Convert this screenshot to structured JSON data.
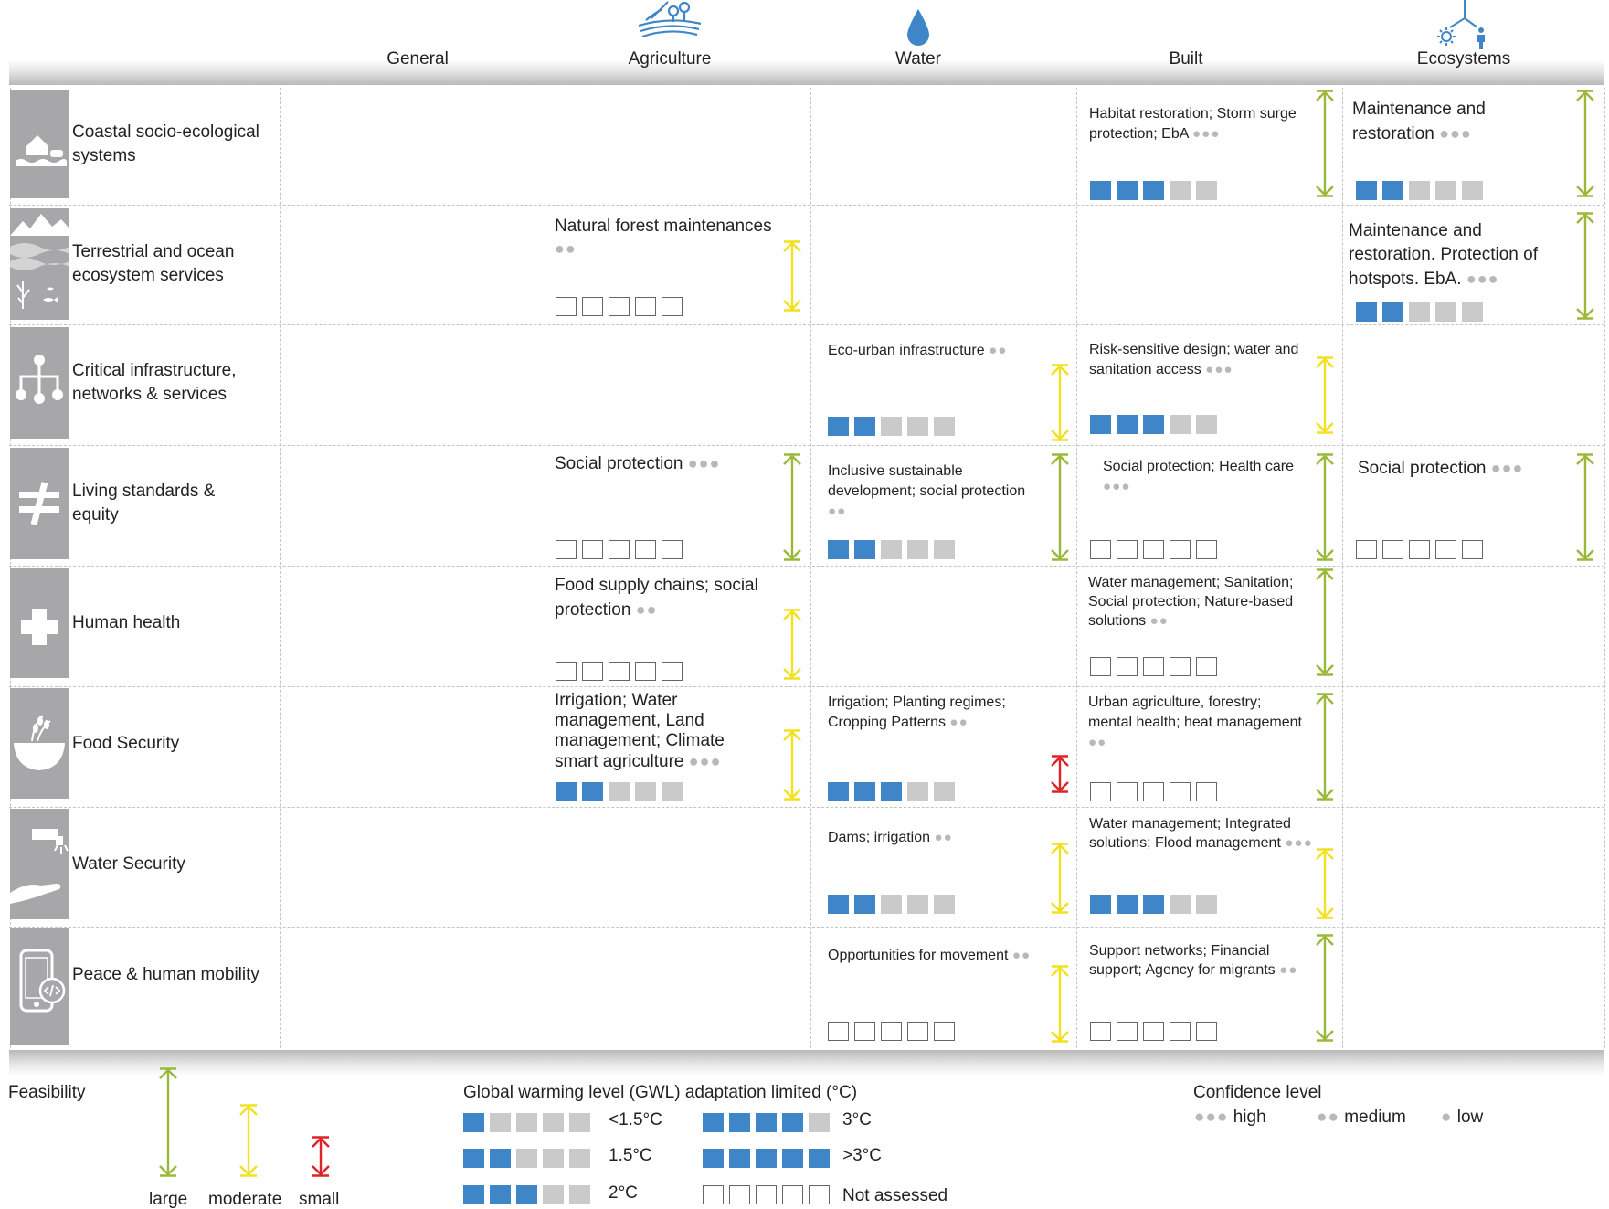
{
  "colors": {
    "blue": "#3f86c8",
    "grey": "#cacaca",
    "icon_bg": "#a7a7a9",
    "large": "#9bb83a",
    "moderate": "#f2e11e",
    "small": "#e02228",
    "dots": "#b8b8b8"
  },
  "columns": [
    {
      "label": "General",
      "icon": ""
    },
    {
      "label": "Agriculture",
      "icon": "fields-icon"
    },
    {
      "label": "Water",
      "icon": "water-drop-icon"
    },
    {
      "label": "Built",
      "icon": ""
    },
    {
      "label": "Ecosystems",
      "icon": "ecosystem-network-icon"
    }
  ],
  "rows": [
    {
      "label": "Coastal socio-ecological systems",
      "icon": "coastal-house-icon"
    },
    {
      "label": "Terrestrial and ocean ecosystem services",
      "icon": "mountain-ocean-icon"
    },
    {
      "label": "Critical infrastructure, networks & services",
      "icon": "network-tree-icon"
    },
    {
      "label": "Living standards & equity",
      "icon": "not-equal-icon"
    },
    {
      "label": "Human health",
      "icon": "health-cross-icon"
    },
    {
      "label": "Food Security",
      "icon": "grain-bowl-icon"
    },
    {
      "label": "Water Security",
      "icon": "tap-hand-icon"
    },
    {
      "label": "Peace & human mobility",
      "icon": "mobile-phone-icon"
    }
  ],
  "options": [
    {
      "row": 0,
      "col": 3,
      "text": "Habitat restoration; Storm surge protection; EbA",
      "confidence": "high",
      "gwl": 3,
      "feasibility": "large"
    },
    {
      "row": 0,
      "col": 4,
      "text": "Maintenance and restoration",
      "confidence": "high",
      "gwl": 2,
      "feasibility": "large"
    },
    {
      "row": 1,
      "col": 1,
      "text": "Natural forest maintenances",
      "confidence": "medium",
      "gwl": 0,
      "feasibility": "moderate"
    },
    {
      "row": 1,
      "col": 4,
      "text": "Maintenance and restoration. Protection of hotspots. EbA.",
      "confidence": "high",
      "gwl": 2,
      "feasibility": "large"
    },
    {
      "row": 2,
      "col": 2,
      "text": "Eco-urban infrastructure",
      "confidence": "medium",
      "gwl": 2,
      "feasibility": "moderate"
    },
    {
      "row": 2,
      "col": 3,
      "text": "Risk-sensitive design; water and sanitation access",
      "confidence": "high",
      "gwl": 3,
      "feasibility": "moderate"
    },
    {
      "row": 3,
      "col": 1,
      "text": "Social protection",
      "confidence": "high",
      "gwl": 0,
      "feasibility": "large"
    },
    {
      "row": 3,
      "col": 2,
      "text": "Inclusive sustainable development; social protection",
      "confidence": "medium",
      "gwl": 2,
      "feasibility": "large"
    },
    {
      "row": 3,
      "col": 3,
      "text": "Social protection; Health care",
      "confidence": "high",
      "gwl": 0,
      "feasibility": "large"
    },
    {
      "row": 3,
      "col": 4,
      "text": "Social protection",
      "confidence": "high",
      "gwl": 0,
      "feasibility": "large"
    },
    {
      "row": 4,
      "col": 1,
      "text": "Food supply chains; social protection",
      "confidence": "medium",
      "gwl": 0,
      "feasibility": "moderate"
    },
    {
      "row": 4,
      "col": 3,
      "text": "Water management; Sanitation; Social protection; Nature-based solutions",
      "confidence": "medium",
      "gwl": 0,
      "feasibility": "large"
    },
    {
      "row": 5,
      "col": 1,
      "text": "Irrigation; Water management, Land management; Climate smart agriculture",
      "confidence": "high",
      "gwl": 2,
      "feasibility": "moderate"
    },
    {
      "row": 5,
      "col": 2,
      "text": "Irrigation; Planting regimes; Cropping Patterns",
      "confidence": "medium",
      "gwl": 3,
      "feasibility": "small"
    },
    {
      "row": 5,
      "col": 3,
      "text": "Urban agriculture, forestry; mental health; heat management",
      "confidence": "medium",
      "gwl": 0,
      "feasibility": "large"
    },
    {
      "row": 6,
      "col": 2,
      "text": "Dams; irrigation",
      "confidence": "medium",
      "gwl": 2,
      "feasibility": "moderate"
    },
    {
      "row": 6,
      "col": 3,
      "text": "Water management; Integrated solutions; Flood management",
      "confidence": "high",
      "gwl": 3,
      "feasibility": "moderate"
    },
    {
      "row": 7,
      "col": 2,
      "text": "Opportunities for movement",
      "confidence": "medium",
      "gwl": 0,
      "feasibility": "moderate"
    },
    {
      "row": 7,
      "col": 3,
      "text": "Support networks; Financial support; Agency for migrants",
      "confidence": "medium",
      "gwl": 0,
      "feasibility": "large"
    }
  ],
  "legend": {
    "feasibility_title": "Feasibility",
    "feasibility_items": [
      {
        "key": "large",
        "label": "large"
      },
      {
        "key": "moderate",
        "label": "moderate"
      },
      {
        "key": "small",
        "label": "small"
      }
    ],
    "gwl_title": "Global warming level (GWL) adaptation limited (°C)",
    "gwl_items": [
      {
        "blue": 1,
        "label": "<1.5°C"
      },
      {
        "blue": 2,
        "label": "1.5°C"
      },
      {
        "blue": 3,
        "label": "2°C"
      },
      {
        "blue": 4,
        "label": "3°C"
      },
      {
        "blue": 5,
        "label": ">3°C"
      },
      {
        "blue": 0,
        "label": "Not assessed"
      }
    ],
    "confidence_title": "Confidence level",
    "confidence_items": [
      {
        "key": "high",
        "label": "high"
      },
      {
        "key": "medium",
        "label": "medium"
      },
      {
        "key": "low",
        "label": "low"
      }
    ]
  }
}
